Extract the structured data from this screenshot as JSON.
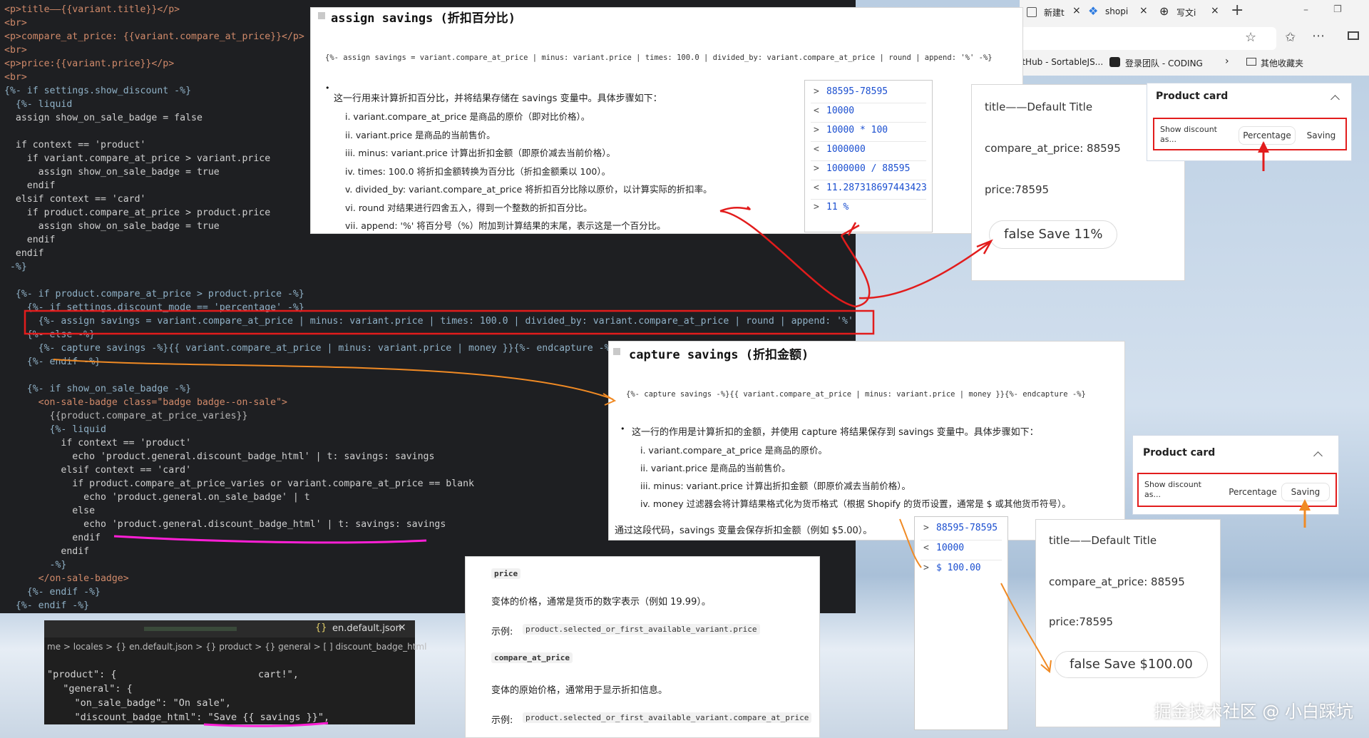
{
  "editor": {
    "lines": [
      "<p>title——{{variant.title}}</p>",
      "<br>",
      "<p>compare_at_price: {{variant.compare_at_price}}</p>",
      "<br>",
      "<p>price:{{variant.price}}</p>",
      "<br>",
      "{%- if settings.show_discount -%}",
      "  {%- liquid",
      "  assign show_on_sale_badge = false",
      "",
      "  if context == 'product'",
      "    if variant.compare_at_price > variant.price",
      "      assign show_on_sale_badge = true",
      "    endif",
      "  elsif context == 'card'",
      "    if product.compare_at_price > product.price",
      "      assign show_on_sale_badge = true",
      "    endif",
      "  endif",
      " -%}",
      "",
      "  {%- if product.compare_at_price > product.price -%}",
      "    {%- if settings.discount_mode == 'percentage' -%}",
      "      {%- assign savings = variant.compare_at_price | minus: variant.price | times: 100.0 | divided_by: variant.compare_at_price | round | append: '%' -%}",
      "    {%- else -%}",
      "      {%- capture savings -%}{{ variant.compare_at_price | minus: variant.price | money }}{%- endcapture -%}",
      "    {%- endif -%}",
      "",
      "    {%- if show_on_sale_badge -%}",
      "      <on-sale-badge class=\"badge badge--on-sale\">",
      "        {{product.compare_at_price_varies}}",
      "        {%- liquid",
      "          if context == 'product'",
      "            echo 'product.general.discount_badge_html' | t: savings: savings",
      "          elsif context == 'card'",
      "            if product.compare_at_price_varies or variant.compare_at_price == blank",
      "              echo 'product.general.on_sale_badge' | t",
      "            else",
      "              echo 'product.general.discount_badge_html' | t: savings: savings",
      "            endif",
      "          endif",
      "        -%}",
      "      </on-sale-badge>",
      "    {%- endif -%}",
      "  {%- endif -%}"
    ]
  },
  "doc1": {
    "title": "assign savings (折扣百分比)",
    "code": "{%- assign savings = variant.compare_at_price | minus: variant.price | times: 100.0 | divided_by: variant.compare_at_price | round | append: '%' -%}",
    "intro": "这一行用来计算折扣百分比，并将结果存储在 savings 变量中。具体步骤如下：",
    "steps": [
      "i.  variant.compare_at_price 是商品的原价（即对比价格）。",
      "ii.  variant.price 是商品的当前售价。",
      "iii.  minus: variant.price 计算出折扣金额（即原价减去当前价格）。",
      "iv.  times: 100.0 将折扣金额转换为百分比（折扣金额乘以 100）。",
      "v.  divided_by: variant.compare_at_price 将折扣百分比除以原价，以计算实际的折扣率。",
      "vi.  round 对结果进行四舍五入，得到一个整数的折扣百分比。",
      "vii.  append: '%' 将百分号（%）附加到计算结果的末尾，表示这是一个百分比。"
    ]
  },
  "doc2": {
    "title": "capture savings (折扣金额)",
    "code": "{%- capture savings -%}{{ variant.compare_at_price | minus: variant.price | money }}{%- endcapture -%}",
    "intro": "这一行的作用是计算折扣的金额，并使用 capture 将结果保存到 savings 变量中。具体步骤如下：",
    "steps": [
      "i.  variant.compare_at_price 是商品的原价。",
      "ii.  variant.price 是商品的当前售价。",
      "iii.  minus: variant.price 计算出折扣金额（即原价减去当前价格）。",
      "iv.  money 过滤器会将计算结果格式化为货币格式（根据 Shopify 的货币设置，通常是 $ 或其他货币符号）。"
    ],
    "summary": "通过这段代码，savings 变量会保存折扣金额（例如 $5.00）。"
  },
  "doc3": {
    "items": [
      {
        "tag": "price",
        "desc": "变体的价格，通常是货币的数字表示（例如 19.99）。",
        "example_label": "示例:",
        "example": "product.selected_or_first_available_variant.price"
      },
      {
        "tag": "compare_at_price",
        "desc": "变体的原始价格，通常用于显示折扣信息。",
        "example_label": "示例:",
        "example": "product.selected_or_first_available_variant.compare_at_price"
      }
    ]
  },
  "console1": {
    "rows": [
      {
        "dir": ">",
        "text": "88595-78595"
      },
      {
        "dir": "<",
        "text": "10000"
      },
      {
        "dir": ">",
        "text": "10000 * 100"
      },
      {
        "dir": "<",
        "text": "1000000"
      },
      {
        "dir": ">",
        "text": "1000000 / 88595"
      },
      {
        "dir": "<",
        "text": "11.287318697443423"
      },
      {
        "dir": ">",
        "text": "11 %"
      }
    ]
  },
  "console2": {
    "rows": [
      {
        "dir": ">",
        "text": "88595-78595"
      },
      {
        "dir": "<",
        "text": "10000"
      },
      {
        "dir": ">",
        "text": "$ 100.00"
      }
    ]
  },
  "preview1": {
    "title": "title——Default Title",
    "compare": "compare_at_price: 88595",
    "price": "price:78595",
    "badge": "false Save 11%"
  },
  "preview2": {
    "title": "title——Default Title",
    "compare": "compare_at_price: 88595",
    "price": "price:78595",
    "badge": "false Save $100.00"
  },
  "setting1": {
    "header": "Product card",
    "label": "Show discount as...",
    "opt1": "Percentage",
    "opt2": "Saving",
    "selected": "Percentage"
  },
  "setting2": {
    "header": "Product card",
    "label": "Show discount as...",
    "opt1": "Percentage",
    "opt2": "Saving",
    "selected": "Saving"
  },
  "browser": {
    "tabs": [
      "新建t",
      "shopi",
      "写文i"
    ],
    "bookmarks": [
      "itHub - SortableJS...",
      "登录团队 - CODING",
      "其他收藏夹"
    ]
  },
  "vscode": {
    "tab": "en.default.json",
    "breadcrumb": "me > locales > {} en.default.json > {} product > {} general > [ ] discount_badge_html",
    "json_lines": [
      "\"product\": {",
      "  \"general\": {",
      "    \"on_sale_badge\": \"On sale\",",
      "    \"discount_badge_html\": \"Save {{ savings }}\","
    ],
    "right_fragment": "cart!\","
  },
  "watermark": "掘金技术社区 @ 小白踩坑",
  "colors": {
    "accent_red": "#e21c1c",
    "annot_orange": "#f08a24",
    "annot_magenta": "#ff1fd6",
    "code_bg": "#1e1f22"
  }
}
